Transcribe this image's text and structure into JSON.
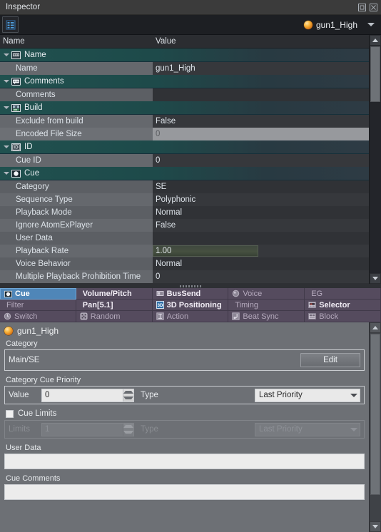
{
  "window": {
    "title": "Inspector",
    "float_icon": "restore-icon",
    "close_icon": "close-icon"
  },
  "toolbar": {
    "list_icon": "list-view-icon",
    "object_name": "gun1_High",
    "object_icon": "cue-sphere-icon",
    "dropdown_icon": "chevron-down-icon"
  },
  "tree": {
    "columns": [
      "Name",
      "Value"
    ],
    "rows": [
      {
        "kind": "group",
        "icon": "name-tag-icon",
        "label": "Name",
        "value": ""
      },
      {
        "kind": "leaf",
        "label": "Name",
        "value": "gun1_High"
      },
      {
        "kind": "group",
        "icon": "comment-bubble-icon",
        "label": "Comments",
        "value": ""
      },
      {
        "kind": "leaf",
        "label": "Comments",
        "value": ""
      },
      {
        "kind": "group",
        "icon": "build-icon",
        "label": "Build",
        "value": ""
      },
      {
        "kind": "leaf",
        "label": "Exclude from build",
        "value": "False"
      },
      {
        "kind": "leaf",
        "label": "Encoded File Size",
        "value": "0",
        "readonly": true
      },
      {
        "kind": "group",
        "icon": "id-badge-icon",
        "label": "ID",
        "value": ""
      },
      {
        "kind": "leaf",
        "label": "Cue ID",
        "value": "0"
      },
      {
        "kind": "group",
        "icon": "cue-sphere-icon",
        "label": "Cue",
        "value": ""
      },
      {
        "kind": "leaf",
        "label": "Category",
        "value": "SE"
      },
      {
        "kind": "leaf",
        "label": "Sequence Type",
        "value": "Polyphonic"
      },
      {
        "kind": "leaf",
        "label": "Playback Mode",
        "value": "Normal"
      },
      {
        "kind": "leaf",
        "label": "Ignore AtomExPlayer",
        "value": "False"
      },
      {
        "kind": "leaf",
        "label": "User Data",
        "value": ""
      },
      {
        "kind": "leaf",
        "label": "Playback Rate",
        "value": "1.00",
        "slider": true
      },
      {
        "kind": "leaf",
        "label": "Voice Behavior",
        "value": "Normal"
      },
      {
        "kind": "leaf",
        "label": "Multiple Playback Prohibition Time",
        "value": "0"
      }
    ],
    "scroll": {
      "up_icon": "scroll-up-icon",
      "down_icon": "scroll-down-icon"
    }
  },
  "tabs": [
    {
      "label": "Cue",
      "icon": "cue-sphere-icon",
      "state": "selected"
    },
    {
      "label": "Volume/Pitch",
      "icon": "",
      "state": "enabled"
    },
    {
      "label": "BusSend",
      "icon": "bus-send-icon",
      "state": "enabled"
    },
    {
      "label": "Voice",
      "icon": "voice-icon",
      "state": "disabled"
    },
    {
      "label": "EG",
      "icon": "",
      "state": "disabled"
    },
    {
      "label": "Filter",
      "icon": "",
      "state": "disabled"
    },
    {
      "label": "Pan[5.1]",
      "icon": "",
      "state": "enabled"
    },
    {
      "label": "3D Positioning",
      "icon": "3d-positioning-icon",
      "state": "enabled"
    },
    {
      "label": "Timing",
      "icon": "",
      "state": "disabled"
    },
    {
      "label": "Selector",
      "icon": "selector-icon",
      "state": "enabled"
    },
    {
      "label": "Switch",
      "icon": "switch-icon",
      "state": "disabled"
    },
    {
      "label": "Random",
      "icon": "random-dice-icon",
      "state": "disabled"
    },
    {
      "label": "Action",
      "icon": "action-icon",
      "state": "disabled"
    },
    {
      "label": "Beat Sync",
      "icon": "beat-sync-icon",
      "state": "disabled"
    },
    {
      "label": "Block",
      "icon": "block-icon",
      "state": "disabled"
    }
  ],
  "panel": {
    "header_name": "gun1_High",
    "header_icon": "cue-sphere-icon",
    "category_label": "Category",
    "category_value": "Main/SE",
    "edit_button": "Edit",
    "priority_label": "Category Cue Priority",
    "priority_value_label": "Value",
    "priority_value": "0",
    "priority_type_label": "Type",
    "priority_type_value": "Last Priority",
    "cue_limits_label": "Cue Limits",
    "cue_limits_checked": false,
    "limits_label": "Limits",
    "limits_value": "1",
    "limits_type_label": "Type",
    "limits_type_value": "Last Priority",
    "user_data_label": "User Data",
    "user_data_value": "",
    "cue_comments_label": "Cue Comments",
    "cue_comments_value": "",
    "scroll": {
      "up_icon": "scroll-up-icon",
      "down_icon": "scroll-down-icon"
    }
  }
}
